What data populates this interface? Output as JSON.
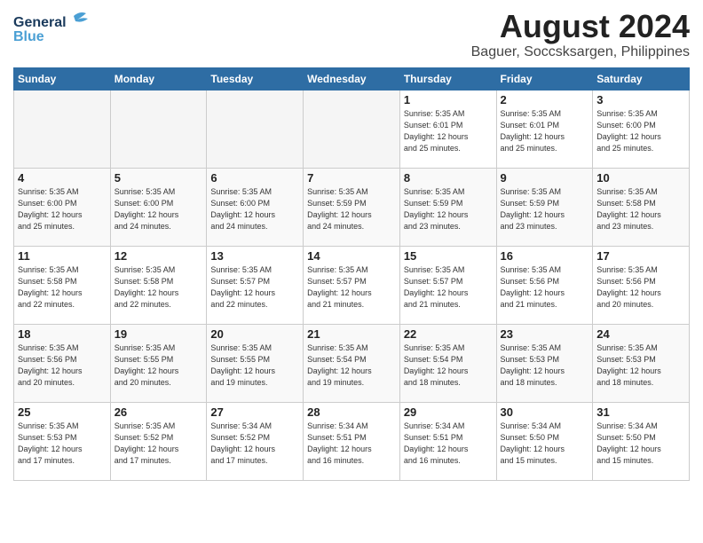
{
  "header": {
    "logo_line1": "General",
    "logo_line2": "Blue",
    "month": "August 2024",
    "location": "Baguer, Soccsksargen, Philippines"
  },
  "weekdays": [
    "Sunday",
    "Monday",
    "Tuesday",
    "Wednesday",
    "Thursday",
    "Friday",
    "Saturday"
  ],
  "weeks": [
    [
      {
        "day": "",
        "info": ""
      },
      {
        "day": "",
        "info": ""
      },
      {
        "day": "",
        "info": ""
      },
      {
        "day": "",
        "info": ""
      },
      {
        "day": "1",
        "info": "Sunrise: 5:35 AM\nSunset: 6:01 PM\nDaylight: 12 hours\nand 25 minutes."
      },
      {
        "day": "2",
        "info": "Sunrise: 5:35 AM\nSunset: 6:01 PM\nDaylight: 12 hours\nand 25 minutes."
      },
      {
        "day": "3",
        "info": "Sunrise: 5:35 AM\nSunset: 6:00 PM\nDaylight: 12 hours\nand 25 minutes."
      }
    ],
    [
      {
        "day": "4",
        "info": "Sunrise: 5:35 AM\nSunset: 6:00 PM\nDaylight: 12 hours\nand 25 minutes."
      },
      {
        "day": "5",
        "info": "Sunrise: 5:35 AM\nSunset: 6:00 PM\nDaylight: 12 hours\nand 24 minutes."
      },
      {
        "day": "6",
        "info": "Sunrise: 5:35 AM\nSunset: 6:00 PM\nDaylight: 12 hours\nand 24 minutes."
      },
      {
        "day": "7",
        "info": "Sunrise: 5:35 AM\nSunset: 5:59 PM\nDaylight: 12 hours\nand 24 minutes."
      },
      {
        "day": "8",
        "info": "Sunrise: 5:35 AM\nSunset: 5:59 PM\nDaylight: 12 hours\nand 23 minutes."
      },
      {
        "day": "9",
        "info": "Sunrise: 5:35 AM\nSunset: 5:59 PM\nDaylight: 12 hours\nand 23 minutes."
      },
      {
        "day": "10",
        "info": "Sunrise: 5:35 AM\nSunset: 5:58 PM\nDaylight: 12 hours\nand 23 minutes."
      }
    ],
    [
      {
        "day": "11",
        "info": "Sunrise: 5:35 AM\nSunset: 5:58 PM\nDaylight: 12 hours\nand 22 minutes."
      },
      {
        "day": "12",
        "info": "Sunrise: 5:35 AM\nSunset: 5:58 PM\nDaylight: 12 hours\nand 22 minutes."
      },
      {
        "day": "13",
        "info": "Sunrise: 5:35 AM\nSunset: 5:57 PM\nDaylight: 12 hours\nand 22 minutes."
      },
      {
        "day": "14",
        "info": "Sunrise: 5:35 AM\nSunset: 5:57 PM\nDaylight: 12 hours\nand 21 minutes."
      },
      {
        "day": "15",
        "info": "Sunrise: 5:35 AM\nSunset: 5:57 PM\nDaylight: 12 hours\nand 21 minutes."
      },
      {
        "day": "16",
        "info": "Sunrise: 5:35 AM\nSunset: 5:56 PM\nDaylight: 12 hours\nand 21 minutes."
      },
      {
        "day": "17",
        "info": "Sunrise: 5:35 AM\nSunset: 5:56 PM\nDaylight: 12 hours\nand 20 minutes."
      }
    ],
    [
      {
        "day": "18",
        "info": "Sunrise: 5:35 AM\nSunset: 5:56 PM\nDaylight: 12 hours\nand 20 minutes."
      },
      {
        "day": "19",
        "info": "Sunrise: 5:35 AM\nSunset: 5:55 PM\nDaylight: 12 hours\nand 20 minutes."
      },
      {
        "day": "20",
        "info": "Sunrise: 5:35 AM\nSunset: 5:55 PM\nDaylight: 12 hours\nand 19 minutes."
      },
      {
        "day": "21",
        "info": "Sunrise: 5:35 AM\nSunset: 5:54 PM\nDaylight: 12 hours\nand 19 minutes."
      },
      {
        "day": "22",
        "info": "Sunrise: 5:35 AM\nSunset: 5:54 PM\nDaylight: 12 hours\nand 18 minutes."
      },
      {
        "day": "23",
        "info": "Sunrise: 5:35 AM\nSunset: 5:53 PM\nDaylight: 12 hours\nand 18 minutes."
      },
      {
        "day": "24",
        "info": "Sunrise: 5:35 AM\nSunset: 5:53 PM\nDaylight: 12 hours\nand 18 minutes."
      }
    ],
    [
      {
        "day": "25",
        "info": "Sunrise: 5:35 AM\nSunset: 5:53 PM\nDaylight: 12 hours\nand 17 minutes."
      },
      {
        "day": "26",
        "info": "Sunrise: 5:35 AM\nSunset: 5:52 PM\nDaylight: 12 hours\nand 17 minutes."
      },
      {
        "day": "27",
        "info": "Sunrise: 5:34 AM\nSunset: 5:52 PM\nDaylight: 12 hours\nand 17 minutes."
      },
      {
        "day": "28",
        "info": "Sunrise: 5:34 AM\nSunset: 5:51 PM\nDaylight: 12 hours\nand 16 minutes."
      },
      {
        "day": "29",
        "info": "Sunrise: 5:34 AM\nSunset: 5:51 PM\nDaylight: 12 hours\nand 16 minutes."
      },
      {
        "day": "30",
        "info": "Sunrise: 5:34 AM\nSunset: 5:50 PM\nDaylight: 12 hours\nand 15 minutes."
      },
      {
        "day": "31",
        "info": "Sunrise: 5:34 AM\nSunset: 5:50 PM\nDaylight: 12 hours\nand 15 minutes."
      }
    ]
  ]
}
